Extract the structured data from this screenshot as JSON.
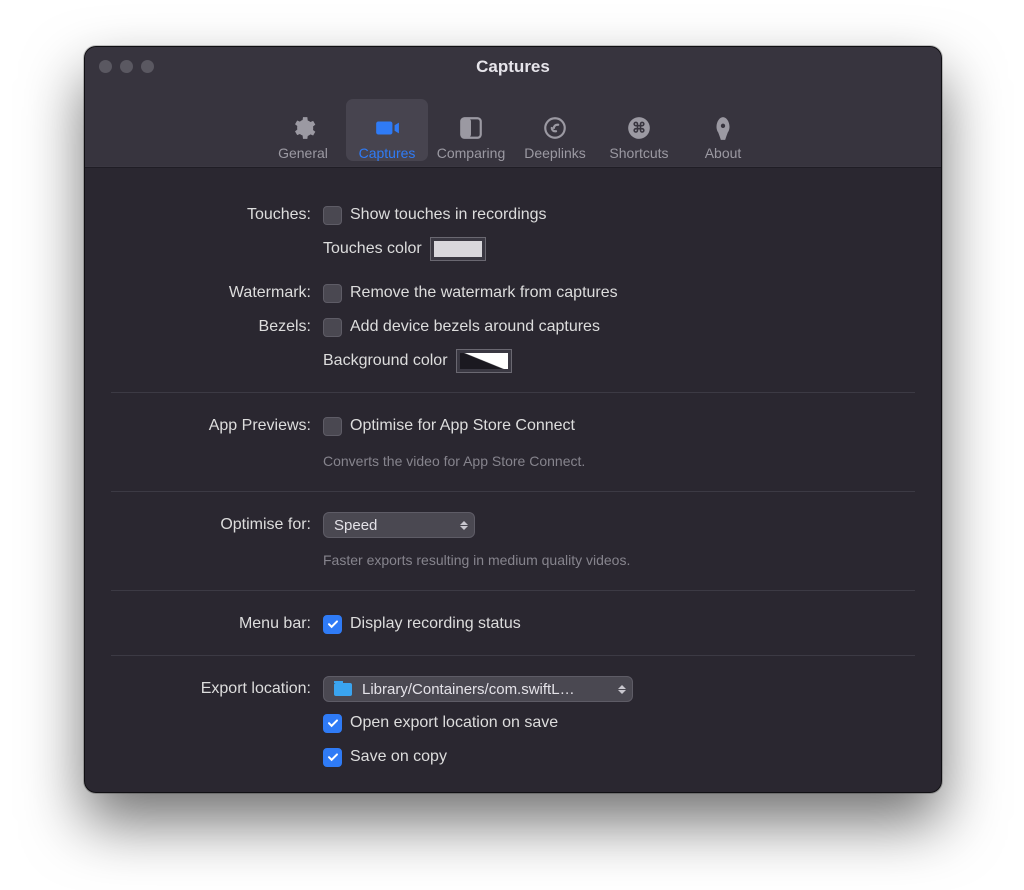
{
  "window": {
    "title": "Captures"
  },
  "tabs": [
    {
      "label": "General"
    },
    {
      "label": "Captures"
    },
    {
      "label": "Comparing"
    },
    {
      "label": "Deeplinks"
    },
    {
      "label": "Shortcuts"
    },
    {
      "label": "About"
    }
  ],
  "touches": {
    "label": "Touches:",
    "checkbox_text": "Show touches in recordings",
    "color_label": "Touches color",
    "color_value": "#d9d7dc"
  },
  "watermark": {
    "label": "Watermark:",
    "checkbox_text": "Remove the watermark from captures"
  },
  "bezels": {
    "label": "Bezels:",
    "checkbox_text": "Add device bezels around captures",
    "bg_color_label": "Background color"
  },
  "app_previews": {
    "label": "App Previews:",
    "checkbox_text": "Optimise for App Store Connect",
    "help": "Converts the video for App Store Connect."
  },
  "optimise": {
    "label": "Optimise for:",
    "selected": "Speed",
    "help": "Faster exports resulting in medium quality videos."
  },
  "menu_bar": {
    "label": "Menu bar:",
    "checkbox_text": "Display recording status"
  },
  "export": {
    "label": "Export location:",
    "selected": "Library/Containers/com.swiftL…",
    "open_on_save": "Open export location on save",
    "save_on_copy": "Save on copy"
  }
}
